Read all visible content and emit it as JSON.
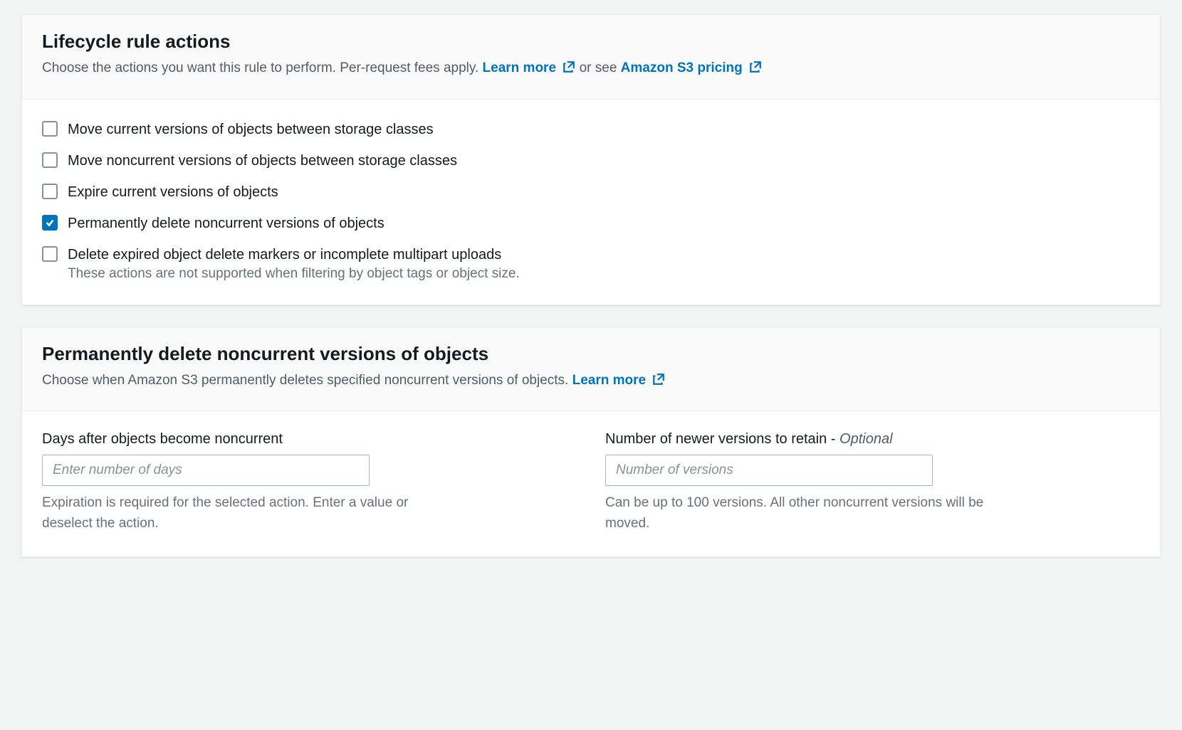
{
  "actionsPanel": {
    "title": "Lifecycle rule actions",
    "subtitlePre": "Choose the actions you want this rule to perform. Per-request fees apply. ",
    "learnMore": "Learn more",
    "orSee": " or see ",
    "pricingLink": "Amazon S3 pricing",
    "checkboxes": {
      "moveCurrent": "Move current versions of objects between storage classes",
      "moveNoncurrent": "Move noncurrent versions of objects between storage classes",
      "expireCurrent": "Expire current versions of objects",
      "deleteNoncurrent": "Permanently delete noncurrent versions of objects",
      "deleteMarkers": "Delete expired object delete markers or incomplete multipart uploads",
      "deleteMarkersSub": "These actions are not supported when filtering by object tags or object size."
    }
  },
  "deletePanel": {
    "title": "Permanently delete noncurrent versions of objects",
    "subtitlePre": "Choose when Amazon S3 permanently deletes specified noncurrent versions of objects. ",
    "learnMore": "Learn more",
    "daysLabel": "Days after objects become noncurrent",
    "daysPlaceholder": "Enter number of days",
    "daysHelp": "Expiration is required for the selected action. Enter a value or deselect the action.",
    "versionsLabelPre": "Number of newer versions to retain - ",
    "versionsLabelOptional": "Optional",
    "versionsPlaceholder": "Number of versions",
    "versionsHelp": "Can be up to 100 versions. All other noncurrent versions will be moved."
  }
}
